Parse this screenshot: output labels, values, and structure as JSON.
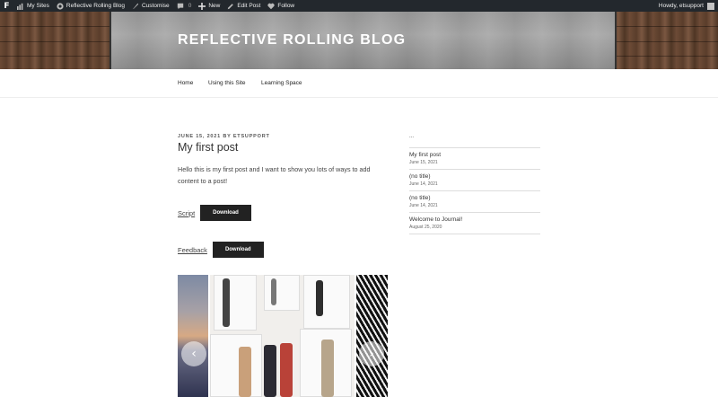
{
  "adminbar": {
    "logo": "F",
    "my_sites": "My Sites",
    "site_name": "Reflective Rolling Blog",
    "customise": "Customise",
    "comments_count": "0",
    "new_label": "New",
    "edit_post": "Edit Post",
    "follow": "Follow",
    "howdy": "Howdy, etsupport"
  },
  "header": {
    "site_title": "REFLECTIVE ROLLING BLOG"
  },
  "nav": {
    "items": [
      {
        "label": "Home"
      },
      {
        "label": "Using this Site"
      },
      {
        "label": "Learning Space"
      }
    ]
  },
  "post": {
    "date": "JUNE 15, 2021",
    "by": "BY",
    "author": "ETSUPPORT",
    "title": "My first post",
    "body": "Hello this is my first post and I want to show you lots of ways to add content to a post!",
    "downloads": [
      {
        "link": "Script",
        "button": "Download"
      },
      {
        "link": "Feedback",
        "button": "Download"
      }
    ],
    "gallery": {
      "prev_icon": "chevron-left-icon",
      "next_icon": "chevron-right-icon"
    }
  },
  "sidebar": {
    "title": "...",
    "items": [
      {
        "title": "My first post",
        "date": "June 15, 2021"
      },
      {
        "title": "(no title)",
        "date": "June 14, 2021"
      },
      {
        "title": "(no title)",
        "date": "June 14, 2021"
      },
      {
        "title": "Welcome to Journal!",
        "date": "August 25, 2020"
      }
    ]
  }
}
